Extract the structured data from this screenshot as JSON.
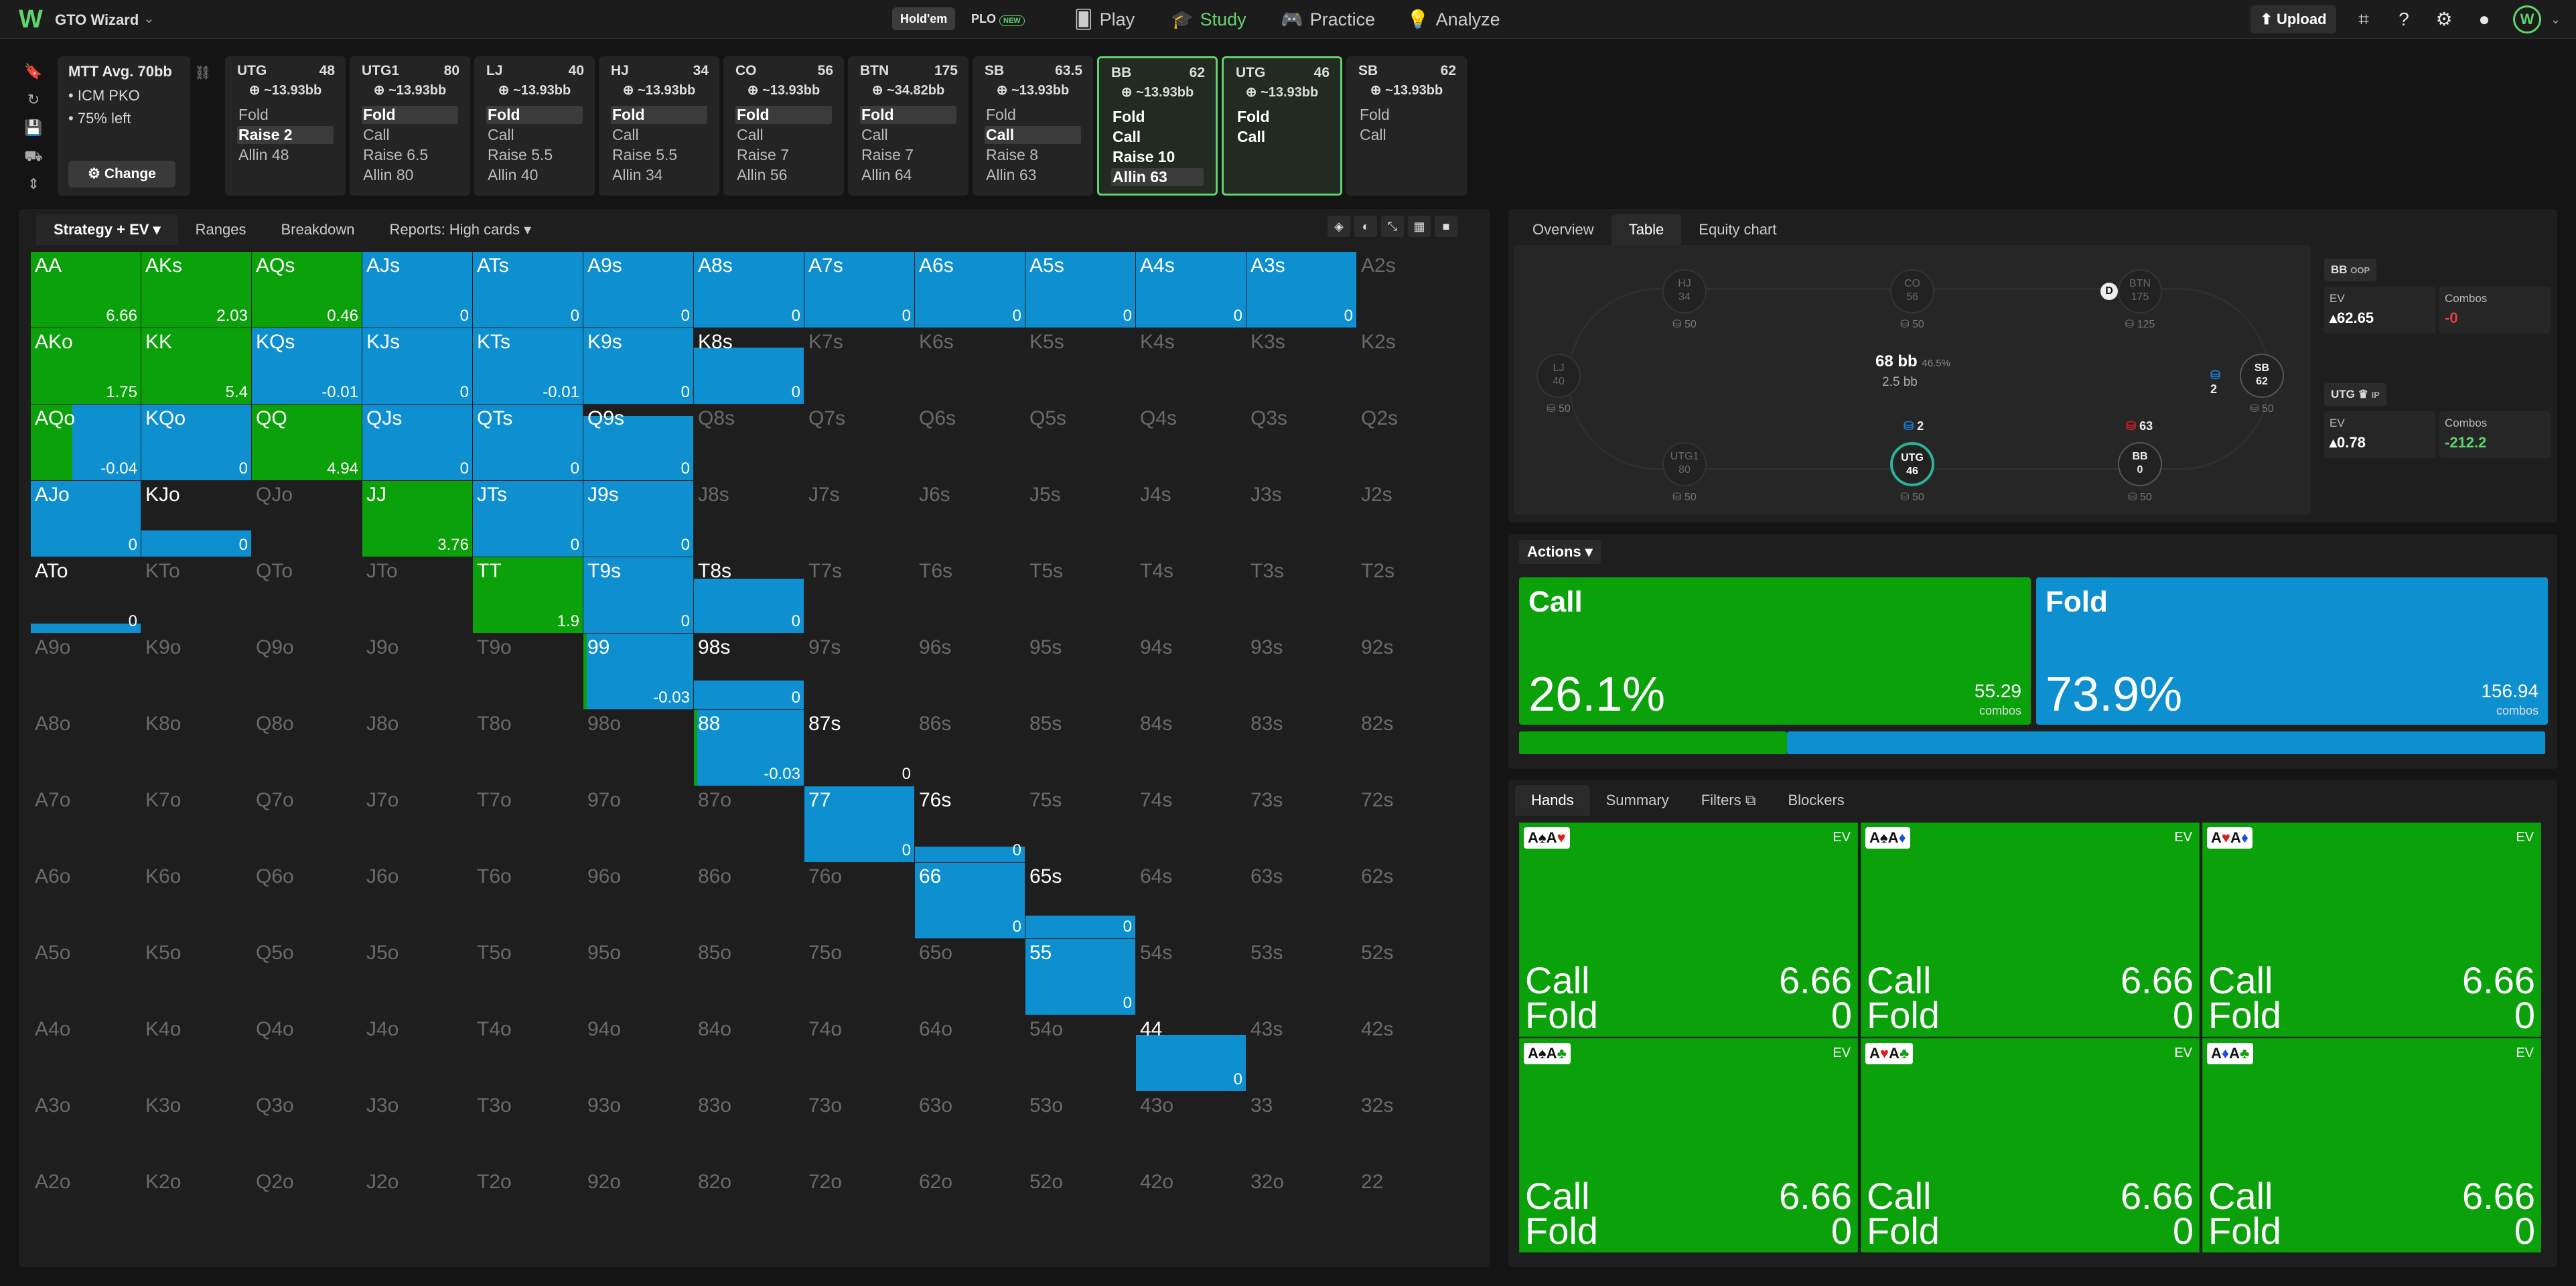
{
  "app": {
    "brand": "GTO Wizard",
    "game_tabs": [
      {
        "label": "Hold'em"
      },
      {
        "label": "PLO",
        "badge": "NEW"
      }
    ],
    "nav": [
      "Play",
      "Study",
      "Practice",
      "Analyze"
    ],
    "active_nav": "Study",
    "upload_label": "Upload"
  },
  "mtt": {
    "title": "MTT",
    "avg": "Avg. 70bb",
    "lines": [
      "ICM PKO",
      "75% left"
    ],
    "change_label": "Change"
  },
  "positions": [
    {
      "name": "UTG",
      "stack": "48",
      "bb": "~13.93bb",
      "actions": [
        {
          "t": "Fold"
        },
        {
          "t": "Raise 2",
          "sel": true
        },
        {
          "t": "Allin 48"
        }
      ]
    },
    {
      "name": "UTG1",
      "stack": "80",
      "bb": "~13.93bb",
      "actions": [
        {
          "t": "Fold",
          "sel": true
        },
        {
          "t": "Call"
        },
        {
          "t": "Raise 6.5"
        },
        {
          "t": "Allin 80"
        }
      ]
    },
    {
      "name": "LJ",
      "stack": "40",
      "bb": "~13.93bb",
      "actions": [
        {
          "t": "Fold",
          "sel": true
        },
        {
          "t": "Call"
        },
        {
          "t": "Raise 5.5"
        },
        {
          "t": "Allin 40"
        }
      ]
    },
    {
      "name": "HJ",
      "stack": "34",
      "bb": "~13.93bb",
      "actions": [
        {
          "t": "Fold",
          "sel": true
        },
        {
          "t": "Call"
        },
        {
          "t": "Raise 5.5"
        },
        {
          "t": "Allin 34"
        }
      ]
    },
    {
      "name": "CO",
      "stack": "56",
      "bb": "~13.93bb",
      "actions": [
        {
          "t": "Fold",
          "sel": true
        },
        {
          "t": "Call"
        },
        {
          "t": "Raise 7"
        },
        {
          "t": "Allin 56"
        }
      ]
    },
    {
      "name": "BTN",
      "stack": "175",
      "bb": "~34.82bb",
      "actions": [
        {
          "t": "Fold",
          "sel": true
        },
        {
          "t": "Call"
        },
        {
          "t": "Raise 7"
        },
        {
          "t": "Allin 64"
        }
      ]
    },
    {
      "name": "SB",
      "stack": "63.5",
      "bb": "~13.93bb",
      "actions": [
        {
          "t": "Fold"
        },
        {
          "t": "Call",
          "sel": true
        },
        {
          "t": "Raise 8"
        },
        {
          "t": "Allin 63"
        }
      ]
    },
    {
      "name": "BB",
      "stack": "62",
      "bb": "~13.93bb",
      "selected": true,
      "actions": [
        {
          "t": "Fold",
          "bright": true
        },
        {
          "t": "Call",
          "bright": true
        },
        {
          "t": "Raise 10",
          "bright": true
        },
        {
          "t": "Allin 63",
          "sel": true
        }
      ]
    },
    {
      "name": "UTG",
      "stack": "46",
      "bb": "~13.93bb",
      "selected": true,
      "actions": [
        {
          "t": "Fold",
          "bright": true
        },
        {
          "t": "Call",
          "bright": true
        }
      ]
    },
    {
      "name": "SB",
      "stack": "62",
      "bb": "~13.93bb",
      "actions": [
        {
          "t": "Fold"
        },
        {
          "t": "Call"
        }
      ]
    }
  ],
  "left_tabs": [
    "Strategy + EV",
    "Ranges",
    "Breakdown",
    "Reports: High cards"
  ],
  "grid": [
    [
      "AA",
      "AKs",
      "AQs",
      "AJs",
      "ATs",
      "A9s",
      "A8s",
      "A7s",
      "A6s",
      "A5s",
      "A4s",
      "A3s",
      "A2s"
    ],
    [
      "AKo",
      "KK",
      "KQs",
      "KJs",
      "KTs",
      "K9s",
      "K8s",
      "K7s",
      "K6s",
      "K5s",
      "K4s",
      "K3s",
      "K2s"
    ],
    [
      "AQo",
      "KQo",
      "QQ",
      "QJs",
      "QTs",
      "Q9s",
      "Q8s",
      "Q7s",
      "Q6s",
      "Q5s",
      "Q4s",
      "Q3s",
      "Q2s"
    ],
    [
      "AJo",
      "KJo",
      "QJo",
      "JJ",
      "JTs",
      "J9s",
      "J8s",
      "J7s",
      "J6s",
      "J5s",
      "J4s",
      "J3s",
      "J2s"
    ],
    [
      "ATo",
      "KTo",
      "QTo",
      "JTo",
      "TT",
      "T9s",
      "T8s",
      "T7s",
      "T6s",
      "T5s",
      "T4s",
      "T3s",
      "T2s"
    ],
    [
      "A9o",
      "K9o",
      "Q9o",
      "J9o",
      "T9o",
      "99",
      "98s",
      "97s",
      "96s",
      "95s",
      "94s",
      "93s",
      "92s"
    ],
    [
      "A8o",
      "K8o",
      "Q8o",
      "J8o",
      "T8o",
      "98o",
      "88",
      "87s",
      "86s",
      "85s",
      "84s",
      "83s",
      "82s"
    ],
    [
      "A7o",
      "K7o",
      "Q7o",
      "J7o",
      "T7o",
      "97o",
      "87o",
      "77",
      "76s",
      "75s",
      "74s",
      "73s",
      "72s"
    ],
    [
      "A6o",
      "K6o",
      "Q6o",
      "J6o",
      "T6o",
      "96o",
      "86o",
      "76o",
      "66",
      "65s",
      "64s",
      "63s",
      "62s"
    ],
    [
      "A5o",
      "K5o",
      "Q5o",
      "J5o",
      "T5o",
      "95o",
      "85o",
      "75o",
      "65o",
      "55",
      "54s",
      "53s",
      "52s"
    ],
    [
      "A4o",
      "K4o",
      "Q4o",
      "J4o",
      "T4o",
      "94o",
      "84o",
      "74o",
      "64o",
      "54o",
      "44",
      "43s",
      "42s"
    ],
    [
      "A3o",
      "K3o",
      "Q3o",
      "J3o",
      "T3o",
      "93o",
      "83o",
      "73o",
      "63o",
      "53o",
      "43o",
      "33",
      "32s"
    ],
    [
      "A2o",
      "K2o",
      "Q2o",
      "J2o",
      "T2o",
      "92o",
      "82o",
      "72o",
      "62o",
      "52o",
      "42o",
      "32o",
      "22"
    ]
  ],
  "cells": {
    "0,0": {
      "call": 1,
      "ev": "6.66"
    },
    "0,1": {
      "call": 1,
      "ev": "2.03"
    },
    "0,2": {
      "call": 1,
      "ev": "0.46"
    },
    "0,3": {
      "call": 0,
      "fold": 1,
      "ev": "0"
    },
    "0,4": {
      "call": 0,
      "fold": 1,
      "ev": "0"
    },
    "0,5": {
      "call": 0,
      "fold": 1,
      "ev": "0"
    },
    "0,6": {
      "call": 0,
      "fold": 1,
      "ev": "0"
    },
    "0,7": {
      "call": 0,
      "fold": 1,
      "ev": "0"
    },
    "0,8": {
      "call": 0,
      "fold": 1,
      "ev": "0"
    },
    "0,9": {
      "call": 0,
      "fold": 1,
      "ev": "0"
    },
    "0,10": {
      "call": 0,
      "fold": 1,
      "ev": "0"
    },
    "0,11": {
      "call": 0,
      "fold": 1,
      "ev": "0"
    },
    "1,0": {
      "call": 1,
      "ev": "1.75"
    },
    "1,1": {
      "call": 1,
      "ev": "5.4"
    },
    "1,2": {
      "call": 0,
      "fold": 1,
      "ev": "-0.01"
    },
    "1,3": {
      "call": 0,
      "fold": 1,
      "ev": "0"
    },
    "1,4": {
      "call": 0,
      "fold": 1,
      "ev": "-0.01"
    },
    "1,5": {
      "call": 0,
      "fold": 1,
      "ev": "0"
    },
    "1,6": {
      "call": 0,
      "fold": 0.75,
      "ev": "0"
    },
    "2,0": {
      "call": 0.38,
      "fold": 1,
      "ev": "-0.04"
    },
    "2,1": {
      "call": 0,
      "fold": 1,
      "ev": "0"
    },
    "2,2": {
      "call": 1,
      "ev": "4.94"
    },
    "2,3": {
      "call": 0,
      "fold": 1,
      "ev": "0"
    },
    "2,4": {
      "call": 0,
      "fold": 1,
      "ev": "0"
    },
    "2,5": {
      "call": 0,
      "fold": 0.85,
      "ev": "0"
    },
    "3,0": {
      "call": 0,
      "fold": 1,
      "ev": "0"
    },
    "3,1": {
      "call": 0,
      "fold": 0.35,
      "ev": "0"
    },
    "3,3": {
      "call": 1,
      "ev": "3.76"
    },
    "3,4": {
      "call": 0,
      "fold": 1,
      "ev": "0"
    },
    "3,5": {
      "call": 0,
      "fold": 1,
      "ev": "0"
    },
    "4,0": {
      "call": 0,
      "fold": 0.12,
      "ev": "0"
    },
    "4,4": {
      "call": 1,
      "ev": "1.9"
    },
    "4,5": {
      "call": 0,
      "fold": 1,
      "ev": "0"
    },
    "4,6": {
      "call": 0,
      "fold": 0.72,
      "ev": "0"
    },
    "5,5": {
      "call": 0.03,
      "fold": 1,
      "ev": "-0.03"
    },
    "5,6": {
      "call": 0,
      "fold": 0.38,
      "ev": "0"
    },
    "6,6": {
      "call": 0.03,
      "fold": 1,
      "ev": "-0.03"
    },
    "6,7": {
      "call": 0,
      "fold": 0,
      "ev": "0"
    },
    "7,7": {
      "call": 0,
      "fold": 1,
      "ev": "0"
    },
    "7,8": {
      "call": 0,
      "fold": 0.2,
      "ev": "0"
    },
    "8,8": {
      "call": 0,
      "fold": 1,
      "ev": "0"
    },
    "8,9": {
      "call": 0,
      "fold": 0.3,
      "ev": "0"
    },
    "9,9": {
      "call": 0,
      "fold": 1,
      "ev": "0"
    },
    "10,10": {
      "call": 0,
      "fold": 0.75,
      "ev": "0"
    }
  },
  "right_tabs": [
    "Overview",
    "Table",
    "Equity chart"
  ],
  "table": {
    "pot": "68 bb",
    "pot_pct": "46.5%",
    "pot_sub": "2.5 bb",
    "seats": [
      {
        "name": "HJ",
        "stack": "34",
        "chips": "50"
      },
      {
        "name": "CO",
        "stack": "56",
        "chips": "50"
      },
      {
        "name": "BTN",
        "stack": "175",
        "chips": "125"
      },
      {
        "name": "LJ",
        "stack": "40",
        "chips": "50"
      },
      {
        "name": "SB",
        "stack": "62",
        "chips": "50"
      },
      {
        "name": "UTG1",
        "stack": "80",
        "chips": "50"
      },
      {
        "name": "UTG",
        "stack": "46",
        "chips": "50"
      },
      {
        "name": "BB",
        "stack": "0",
        "chips": "50"
      }
    ],
    "bet_utg": "2",
    "bet_bb": "63",
    "bet_sb": "2",
    "dealer": "D"
  },
  "bb_box": {
    "name": "BB",
    "tag": "OOP",
    "ev_label": "EV",
    "ev": "62.65",
    "combos_label": "Combos",
    "combos": "0"
  },
  "utg_box": {
    "name": "UTG",
    "tag": "IP",
    "ev_label": "EV",
    "ev": "0.78",
    "combos_label": "Combos",
    "combos": "212.2"
  },
  "actions": {
    "label": "Actions",
    "items": [
      {
        "name": "Call",
        "pct": "26.1%",
        "combos": "55.29",
        "color": "#0aa10a"
      },
      {
        "name": "Fold",
        "pct": "73.9%",
        "combos": "156.94",
        "color": "#0e8fd0"
      }
    ],
    "combos_label": "combos",
    "call_share": 0.261
  },
  "hands_tabs": [
    "Hands",
    "Summary",
    "Filters",
    "Blockers"
  ],
  "hands": [
    {
      "cards": [
        [
          "A",
          "♠",
          "k"
        ],
        [
          "A",
          "♥",
          "r"
        ]
      ],
      "call": "6.66",
      "fold": "0"
    },
    {
      "cards": [
        [
          "A",
          "♠",
          "k"
        ],
        [
          "A",
          "♦",
          "b"
        ]
      ],
      "call": "6.66",
      "fold": "0"
    },
    {
      "cards": [
        [
          "A",
          "♥",
          "r"
        ],
        [
          "A",
          "♦",
          "b"
        ]
      ],
      "call": "6.66",
      "fold": "0"
    },
    {
      "cards": [
        [
          "A",
          "♠",
          "k"
        ],
        [
          "A",
          "♣",
          "g"
        ]
      ],
      "call": "6.66",
      "fold": "0"
    },
    {
      "cards": [
        [
          "A",
          "♥",
          "r"
        ],
        [
          "A",
          "♣",
          "g"
        ]
      ],
      "call": "6.66",
      "fold": "0"
    },
    {
      "cards": [
        [
          "A",
          "♦",
          "b"
        ],
        [
          "A",
          "♣",
          "g"
        ]
      ],
      "call": "6.66",
      "fold": "0"
    }
  ],
  "hand_labels": {
    "call": "Call",
    "fold": "Fold",
    "ev": "EV"
  },
  "colors": {
    "call": "#0aa10a",
    "fold": "#0e8fd0",
    "accent": "#5fd36c"
  }
}
